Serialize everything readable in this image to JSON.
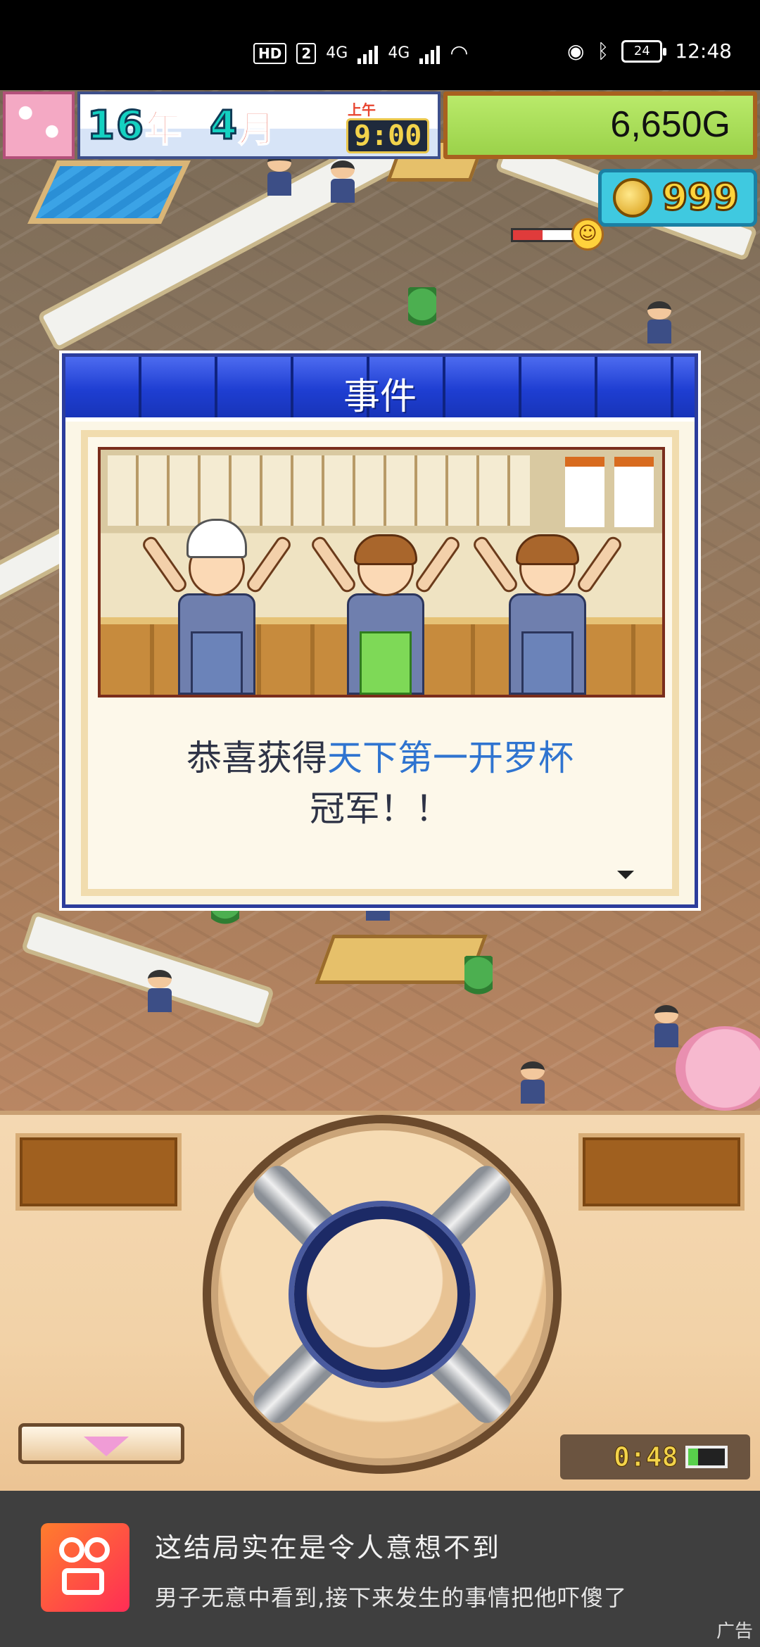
{
  "status_bar": {
    "hd_badge": "HD",
    "sim1_badge": "2",
    "sim1_network": "4G",
    "sim2_network": "4G",
    "battery_level": "24",
    "clock": "12:48"
  },
  "hud": {
    "year_value": "16",
    "year_unit": "年",
    "month_value": "4",
    "month_unit": "月",
    "ampm": "上午",
    "time": "9:00",
    "money": "6,650G",
    "coins": "999",
    "mood_level": 0.4
  },
  "dialog": {
    "title": "事件",
    "message_prefix": "恭喜获得",
    "message_highlight": "天下第一开罗杯",
    "message_suffix": "冠军！！"
  },
  "controller": {
    "timer": "0:48"
  },
  "ad": {
    "title": "这结局实在是令人意想不到",
    "description": "男子无意中看到,接下来发生的事情把他吓傻了",
    "tag": "广告"
  },
  "colors": {
    "dialog_header": "#1e3ed2",
    "highlight_text": "#2f74d0",
    "money_panel": "#9bd24a",
    "coin_panel": "#3fc9e0"
  }
}
